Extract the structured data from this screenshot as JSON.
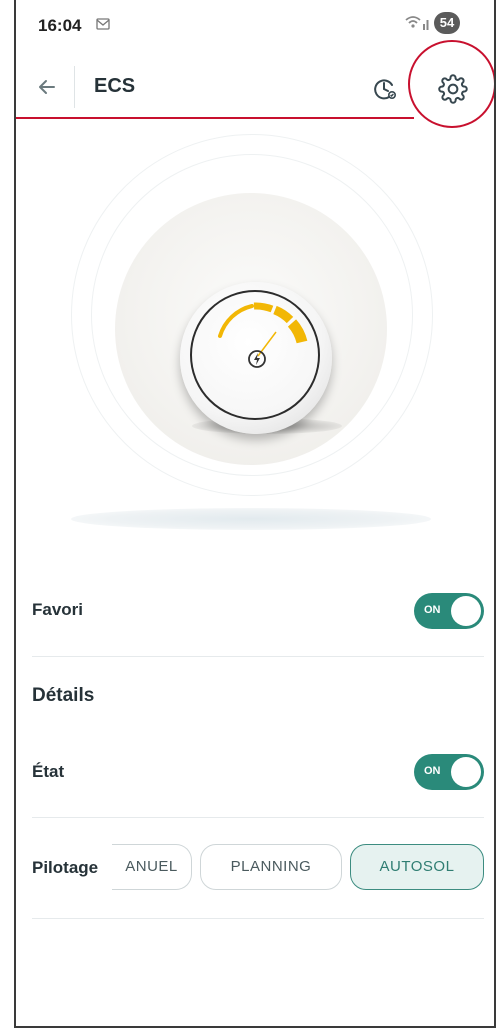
{
  "status_bar": {
    "time": "16:04",
    "battery": "54"
  },
  "app_bar": {
    "title": "ECS"
  },
  "favori": {
    "label": "Favori",
    "toggle_text": "ON",
    "on": true
  },
  "details": {
    "title": "Détails"
  },
  "etat": {
    "label": "État",
    "toggle_text": "ON",
    "on": true
  },
  "pilotage": {
    "label": "Pilotage",
    "options": [
      {
        "label": "ANUEL",
        "selected": false
      },
      {
        "label": "PLANNING",
        "selected": false
      },
      {
        "label": "AUTOSOL",
        "selected": true
      }
    ]
  },
  "colors": {
    "accent": "#2a8a7a",
    "annotation": "#c8102e",
    "gauge": "#f2b705"
  },
  "icons": [
    "back-arrow-icon",
    "history-icon",
    "gear-icon",
    "mail-icon",
    "wifi-icon",
    "bolt-icon"
  ]
}
